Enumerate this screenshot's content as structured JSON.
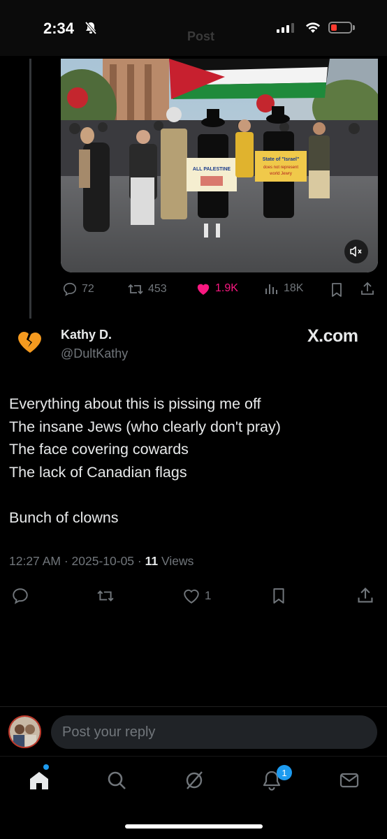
{
  "status_bar": {
    "time": "2:34"
  },
  "header_ghost": "Post",
  "video_post": {
    "banner_1": "ALL PALESTINE",
    "banner_2": "State of \"Israel\" does not represent world Jewry",
    "stats": {
      "replies": "72",
      "reposts": "453",
      "likes": "1.9K",
      "views": "18K"
    }
  },
  "tweet": {
    "author_name": "Kathy D.",
    "author_handle": "@DultKathy",
    "source_label": "X.com",
    "text": "Everything about this is pissing me off\nThe insane Jews (who clearly don't pray)\nThe face covering cowards\nThe lack of Canadian flags\n\nBunch of clowns",
    "time": "12:27 AM",
    "date": "2025-10-05",
    "views_count": "11",
    "views_label": "Views",
    "like_count": "1"
  },
  "reply": {
    "placeholder": "Post your reply"
  },
  "tabbar": {
    "notifications_badge": "1"
  },
  "colors": {
    "accent": "#1d9bf0",
    "like": "#f91880",
    "muted": "#71767b"
  }
}
